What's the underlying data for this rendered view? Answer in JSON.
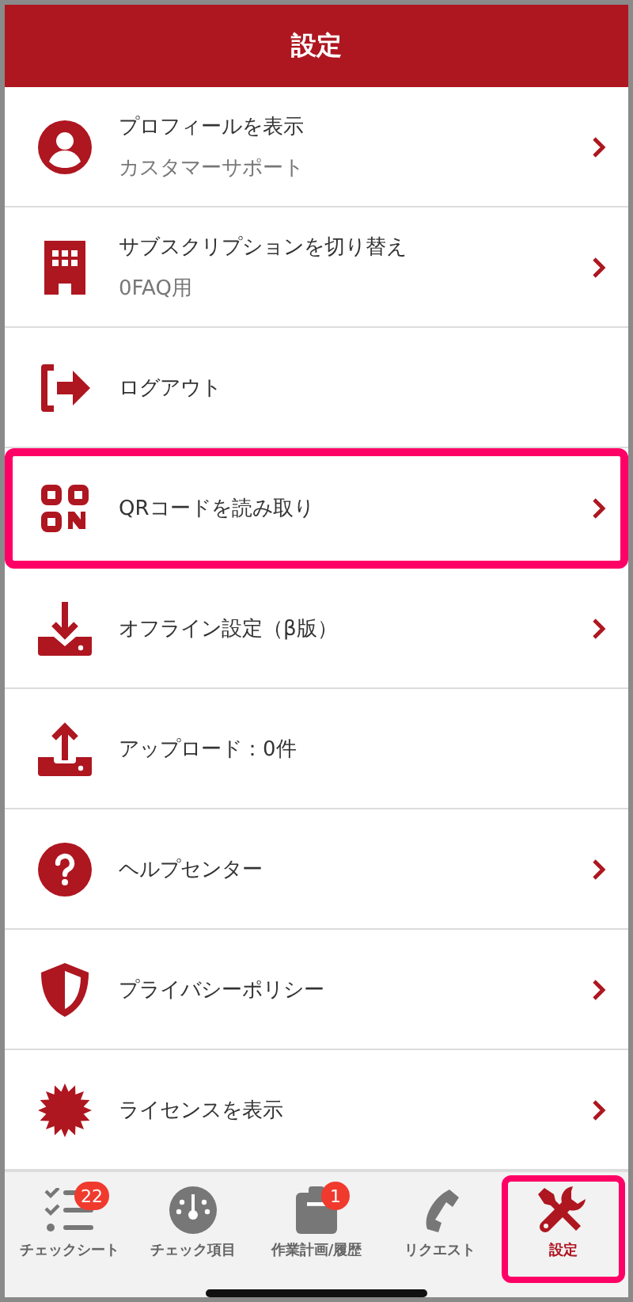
{
  "header": {
    "title": "設定"
  },
  "items": [
    {
      "kind": "profile",
      "title": "プロフィールを表示",
      "subtitle": "カスタマーサポート",
      "chevron": true,
      "highlighted": false
    },
    {
      "kind": "building",
      "title": "サブスクリプションを切り替え",
      "subtitle": "0FAQ用",
      "chevron": true,
      "highlighted": false
    },
    {
      "kind": "logout",
      "title": "ログアウト",
      "chevron": false,
      "highlighted": false
    },
    {
      "kind": "qr",
      "title": "QRコードを読み取り",
      "chevron": true,
      "highlighted": true
    },
    {
      "kind": "download",
      "title": "オフライン設定（β版）",
      "chevron": true,
      "highlighted": false
    },
    {
      "kind": "upload",
      "title": "アップロード：0件",
      "chevron": false,
      "highlighted": false
    },
    {
      "kind": "help",
      "title": "ヘルプセンター",
      "chevron": true,
      "highlighted": false
    },
    {
      "kind": "shield",
      "title": "プライバシーポリシー",
      "chevron": true,
      "highlighted": false
    },
    {
      "kind": "license",
      "title": "ライセンスを表示",
      "chevron": true,
      "highlighted": false
    }
  ],
  "tabs": [
    {
      "kind": "checklist",
      "label": "チェックシート",
      "badge": "22",
      "selected": false,
      "highlighted": false
    },
    {
      "kind": "gauge",
      "label": "チェック項目",
      "selected": false,
      "highlighted": false
    },
    {
      "kind": "clipboard",
      "label": "作業計画/履歴",
      "badge": "1",
      "selected": false,
      "highlighted": false
    },
    {
      "kind": "phone",
      "label": "リクエスト",
      "selected": false,
      "highlighted": false
    },
    {
      "kind": "tools",
      "label": "設定",
      "selected": true,
      "highlighted": true
    }
  ]
}
